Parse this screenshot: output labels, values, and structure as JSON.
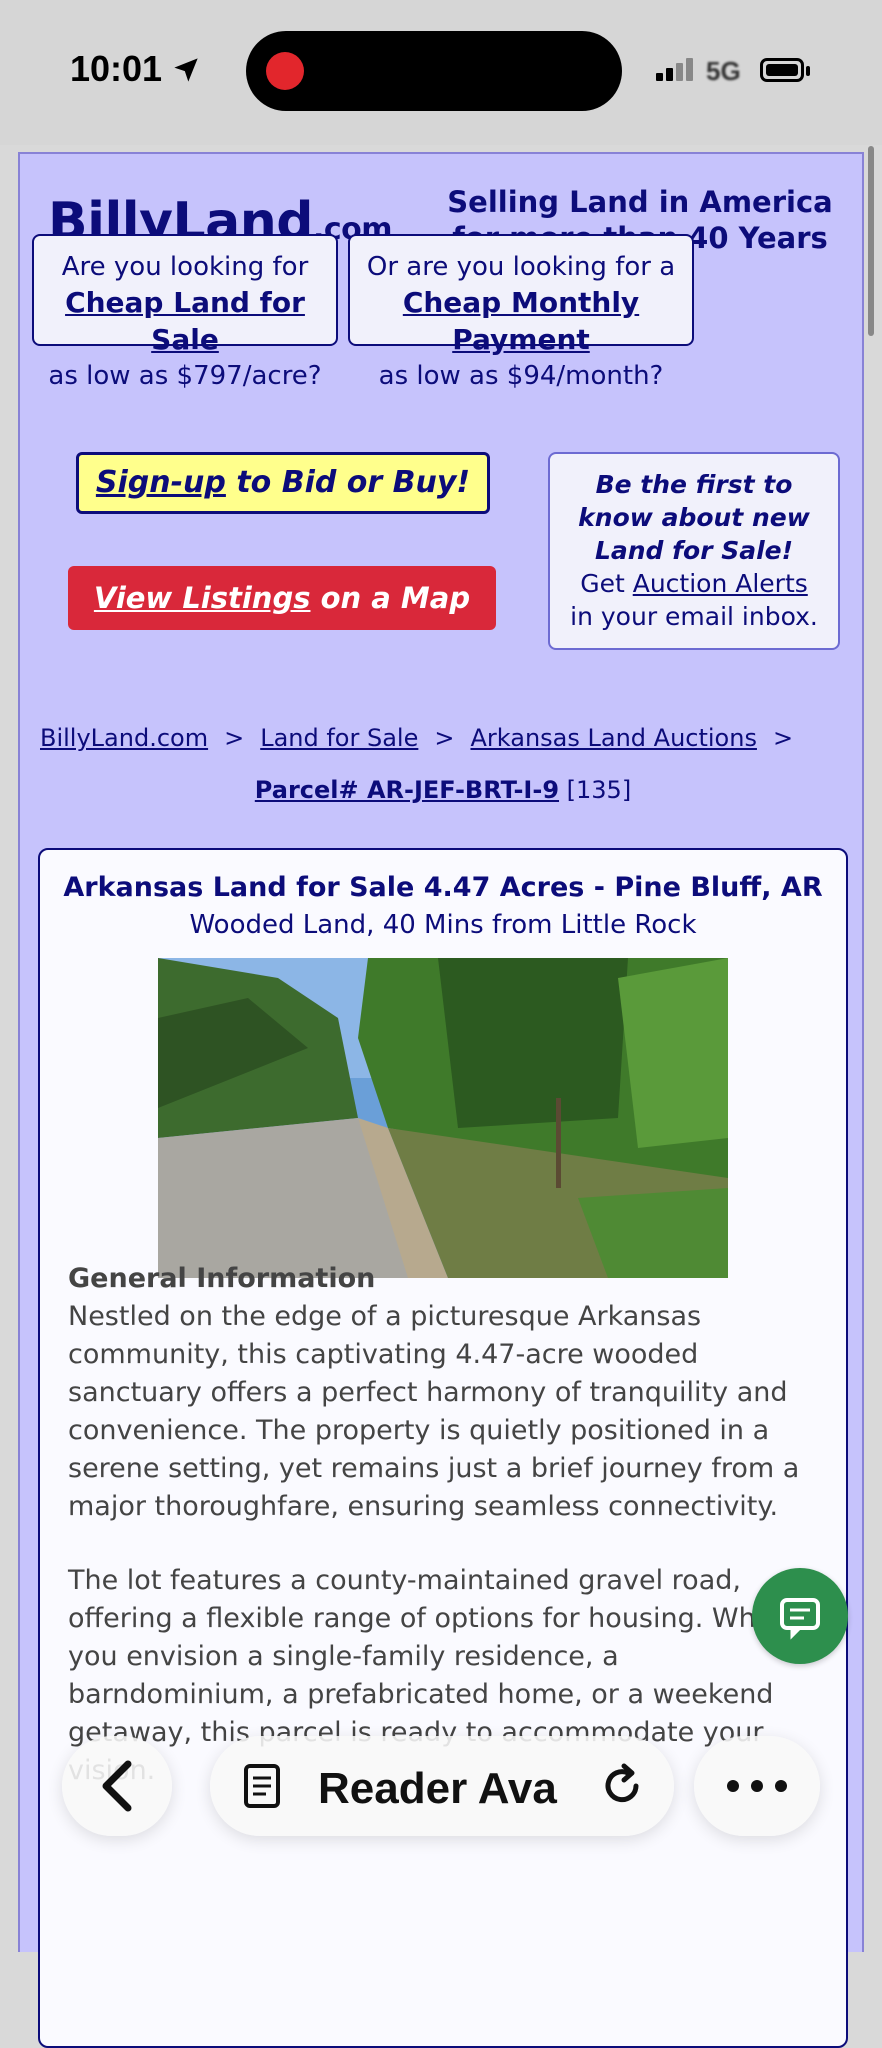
{
  "status_bar": {
    "time": "10:01",
    "network": "5G"
  },
  "header": {
    "logo_main": "BillyLand",
    "logo_suffix": ".com",
    "tagline_line1": "Selling Land in America",
    "tagline_line2": "for more than 40 Years"
  },
  "promo_left": {
    "line1": "Are you looking for",
    "link": "Cheap Land for Sale",
    "line3": "as low as $797/acre?"
  },
  "promo_right": {
    "line1": "Or are you looking for a",
    "link": "Cheap Monthly Payment",
    "line3": "as low as $94/month?"
  },
  "signup": {
    "link": "Sign-up",
    "rest": " to Bid or Buy!"
  },
  "map_button": {
    "link": "View Listings",
    "rest": " on a Map"
  },
  "alerts": {
    "line1": "Be the first to",
    "line2": "know about new",
    "line3": "Land for Sale!",
    "get": "Get ",
    "link": "Auction Alerts",
    "line5": "in your email inbox."
  },
  "breadcrumb": {
    "items": [
      "BillyLand.com",
      "Land for Sale",
      "Arkansas Land Auctions"
    ],
    "sep": ">",
    "parcel_label": "Parcel# AR-JEF-BRT-I-9",
    "parcel_count": " [135]"
  },
  "listing": {
    "title": "Arkansas Land for Sale 4.47 Acres - Pine Bluff, AR",
    "subtitle": "Wooded Land, 40 Mins from Little Rock",
    "section_heading": "General Information",
    "para1": "Nestled on the edge of a picturesque Arkansas community, this captivating 4.47-acre wooded sanctuary offers a perfect harmony of tranquility and convenience. The property is quietly positioned in a serene setting, yet remains just a brief journey from a major thoroughfare, ensuring seamless connectivity.",
    "para2": "The lot features a county-maintained gravel road, offering a flexible range of options for housing. Whether you envision a single-family residence, a barndominium, a prefabricated home, or a weekend getaway, this parcel is ready to accommodate your vision."
  },
  "browser_toolbar": {
    "reader_label": "Reader Ava"
  }
}
